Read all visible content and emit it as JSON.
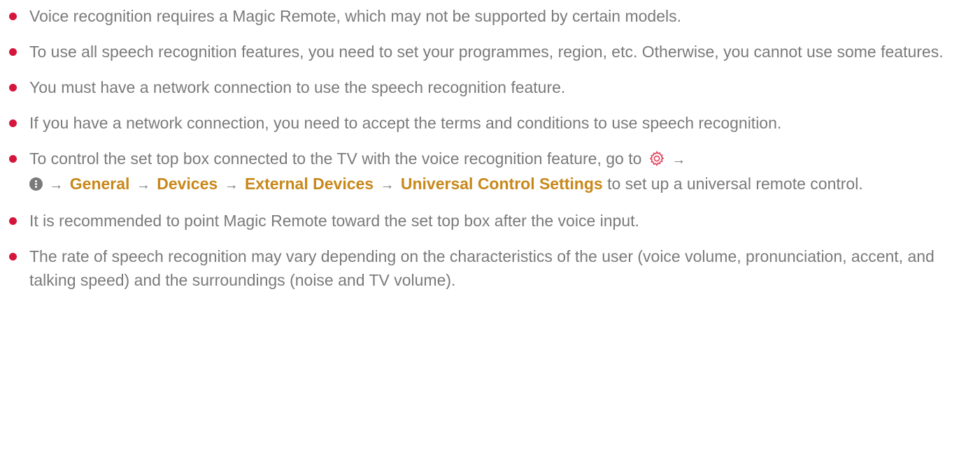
{
  "notes": [
    {
      "text": "Voice recognition requires a Magic Remote, which may not be supported by certain models."
    },
    {
      "text": "To use all speech recognition features, you need to set your programmes, region, etc. Otherwise, you cannot use some features."
    },
    {
      "text": "You must have a network connection to use the speech recognition feature."
    },
    {
      "text": "If you have a network connection, you need to accept the terms and conditions to use speech recognition."
    },
    {
      "text_before": "To control the set top box connected to the TV with the voice recognition feature, go to",
      "path": [
        "General",
        "Devices",
        "External Devices",
        "Universal Control Settings"
      ],
      "text_after": "to set up a universal remote control.",
      "icons": [
        "settings-gear-icon",
        "more-options-icon"
      ]
    },
    {
      "text": "It is recommended to point Magic Remote toward the set top box after the voice input."
    },
    {
      "text": "The rate of speech recognition may vary depending on the characteristics of the user (voice volume, pronunciation, accent, and talking speed) and the surroundings (noise and TV volume)."
    }
  ],
  "colors": {
    "bullet": "#d4163c",
    "text": "#7a7a7a",
    "menu_path": "#c8881a",
    "gear_icon": "#e0405a"
  },
  "arrow_glyph": "→"
}
